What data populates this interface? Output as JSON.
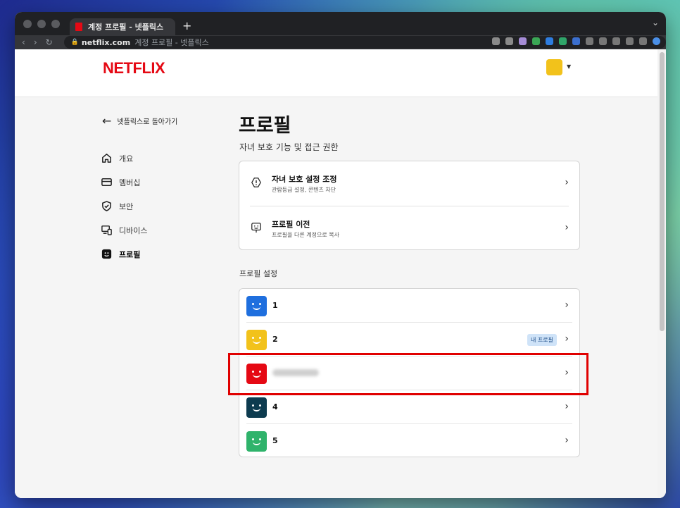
{
  "browser": {
    "tab_title": "계정 프로필 - 넷플릭스",
    "new_tab": "+",
    "url_domain": "netflix.com",
    "url_title": "계정 프로필 - 넷플릭스"
  },
  "header": {
    "logo": "NETFLIX"
  },
  "sidebar": {
    "back_label": "넷플릭스로 돌아가기",
    "items": [
      {
        "label": "개요",
        "icon": "home-icon"
      },
      {
        "label": "멤버십",
        "icon": "card-icon"
      },
      {
        "label": "보안",
        "icon": "shield-icon"
      },
      {
        "label": "디바이스",
        "icon": "devices-icon"
      },
      {
        "label": "프로필",
        "icon": "profile-icon",
        "active": true
      }
    ]
  },
  "main": {
    "title": "프로필",
    "section1_label": "자녀 보호 기능 및 접근 권한",
    "settings": [
      {
        "title": "자녀 보호 설정 조정",
        "subtitle": "관람등급 설정, 콘텐츠 차단"
      },
      {
        "title": "프로필 이전",
        "subtitle": "프로필을 다른 계정으로 복사"
      }
    ],
    "section2_label": "프로필 설정",
    "profiles": [
      {
        "name": "1",
        "color": "#1f6fde"
      },
      {
        "name": "2",
        "color": "#f2c21b",
        "badge": "내 프로필"
      },
      {
        "name": "",
        "color": "#e50914",
        "blurred": true
      },
      {
        "name": "4",
        "color": "#0d3b4f"
      },
      {
        "name": "5",
        "color": "#2fb36b"
      }
    ]
  },
  "colors": {
    "brand": "#e50914",
    "highlight": "#e00000"
  }
}
